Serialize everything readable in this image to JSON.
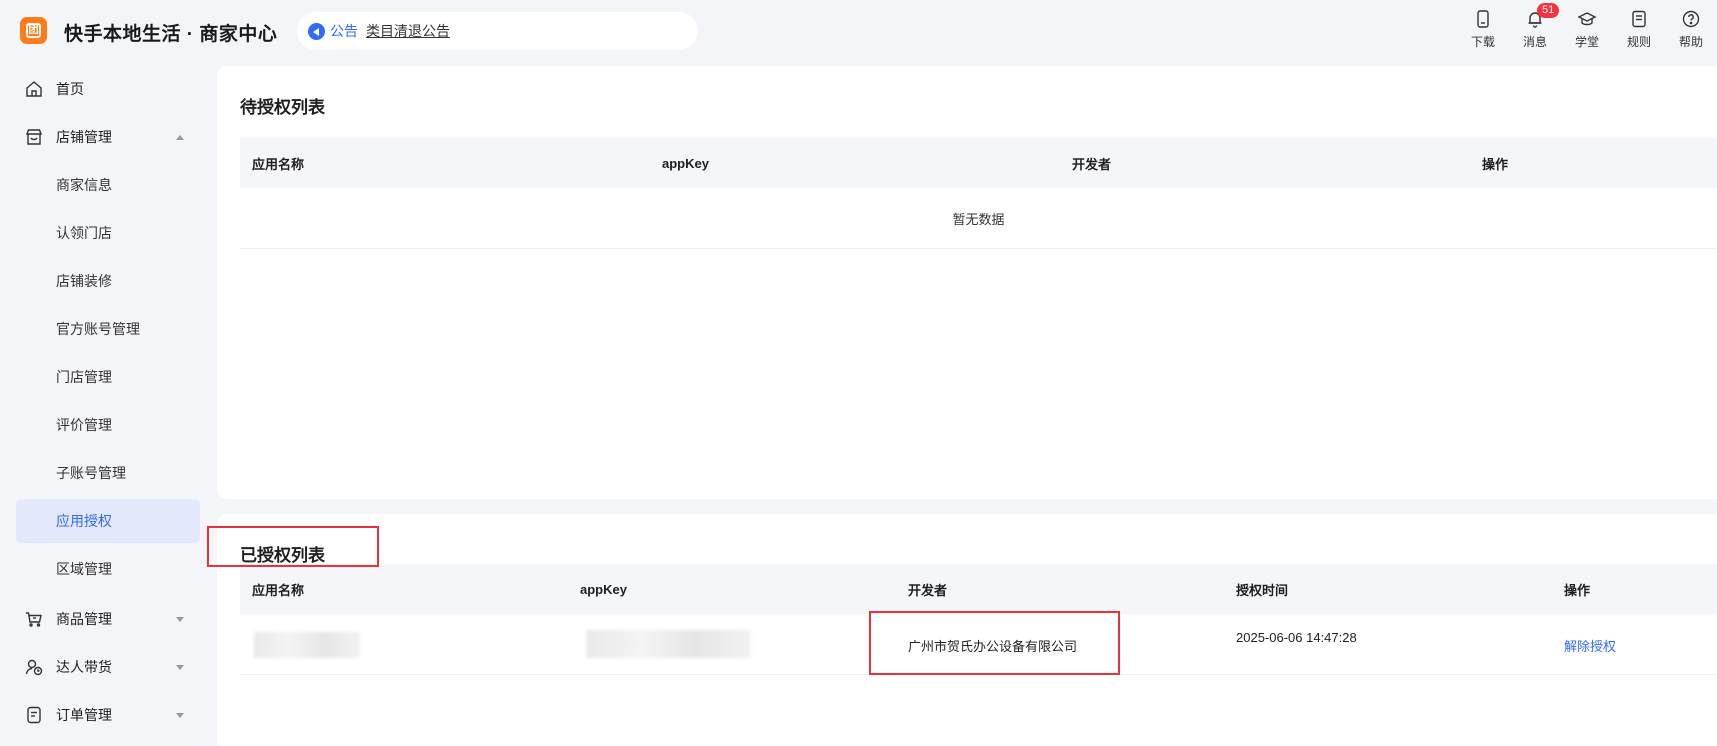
{
  "header": {
    "brand": "快手本地生活 · 商家中心",
    "logo_glyph": "团",
    "notice": {
      "label": "公告",
      "link": "类目清退公告"
    },
    "tools": [
      {
        "label": "下载",
        "icon": "download-icon"
      },
      {
        "label": "消息",
        "icon": "bell-icon",
        "badge": "51"
      },
      {
        "label": "学堂",
        "icon": "graduation-cap-icon"
      },
      {
        "label": "规则",
        "icon": "document-icon"
      },
      {
        "label": "帮助",
        "icon": "help-icon"
      }
    ]
  },
  "sidebar": {
    "home": "首页",
    "store": {
      "label": "店铺管理",
      "items": [
        "商家信息",
        "认领门店",
        "店铺装修",
        "官方账号管理",
        "门店管理",
        "评价管理",
        "子账号管理",
        "应用授权",
        "区域管理"
      ],
      "active": "应用授权"
    },
    "goods": "商品管理",
    "influencer": "达人带货",
    "orders": "订单管理"
  },
  "pending": {
    "title": "待授权列表",
    "columns": [
      "应用名称",
      "appKey",
      "开发者",
      "操作"
    ],
    "empty_text": "暂无数据"
  },
  "authorized": {
    "title": "已授权列表",
    "columns": [
      "应用名称",
      "appKey",
      "开发者",
      "授权时间",
      "操作"
    ],
    "rows": [
      {
        "app_name": "",
        "app_key_suffix": "...000170",
        "developer": "广州市贺氏办公设备有限公司",
        "auth_time": "2025-06-06 14:47:28",
        "action": "解除授权"
      }
    ]
  },
  "colors": {
    "accent": "#326bfb",
    "highlight": "#e8323a",
    "logo": "#ff7a18",
    "badge": "#f5333f"
  }
}
